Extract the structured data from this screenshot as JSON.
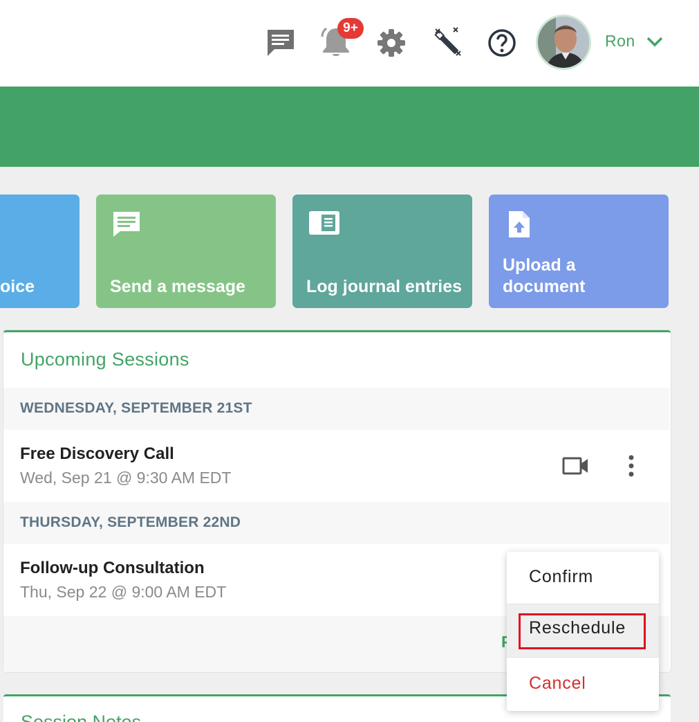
{
  "header": {
    "icons": [
      "message-icon",
      "bell-icon",
      "gear-icon",
      "magic-wand-icon",
      "help-icon"
    ],
    "notification_badge": "9+",
    "user_name": "Ron"
  },
  "tiles": [
    {
      "label": "oice",
      "color": "#5aade6"
    },
    {
      "label": "Send a message",
      "color": "#85c486",
      "icon": "message-icon"
    },
    {
      "label": "Log journal entries",
      "color": "#5fa69b",
      "icon": "journal-icon"
    },
    {
      "label_line1": "Upload a",
      "label_line2": "document",
      "color": "#7c9be8",
      "icon": "upload-document-icon"
    }
  ],
  "upcoming": {
    "title": "Upcoming Sessions",
    "days": [
      {
        "header": "WEDNESDAY, SEPTEMBER 21ST",
        "session": {
          "title": "Free Discovery Call",
          "time": "Wed, Sep 21 @ 9:30 AM EDT"
        }
      },
      {
        "header": "THURSDAY, SEPTEMBER 22ND",
        "session": {
          "title": "Follow-up Consultation",
          "time": "Thu, Sep 22 @ 9:00 AM EDT"
        }
      }
    ],
    "footer_link": "P"
  },
  "notes_card": {
    "title": "Session Notes"
  },
  "context_menu": {
    "items": [
      {
        "label": "Confirm",
        "color": "#212121"
      },
      {
        "label": "Reschedule",
        "color": "#212121"
      },
      {
        "label": "Cancel",
        "color": "#d32f2f"
      }
    ]
  },
  "colors": {
    "brand_green": "#43a366",
    "highlight_red": "#e0101e",
    "banner": "#43a366"
  }
}
